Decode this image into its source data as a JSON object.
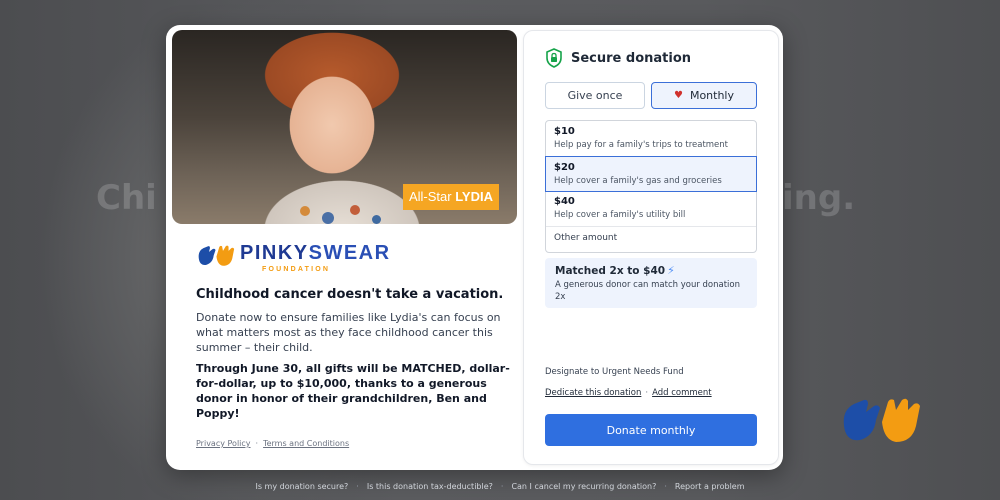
{
  "background": {
    "text_left": "Chi",
    "text_right": "ing."
  },
  "photo": {
    "tag_prefix": "All-Star",
    "tag_name": "LYDIA"
  },
  "brand": {
    "name_part1": "PINKY",
    "name_part2": "SWEAR",
    "sub": "FOUNDATION",
    "accent": "#f39c12",
    "primary": "#1f3a93"
  },
  "content": {
    "headline": "Childhood cancer doesn't take a vacation.",
    "body": "Donate now to ensure families like Lydia's can focus on what matters most as they face childhood cancer this summer – their child.",
    "match_notice": "Through June 30, all gifts will be MATCHED, dollar-for-dollar, up to $10,000, thanks to a generous donor in honor of their grandchildren, Ben and Poppy!"
  },
  "legal": {
    "privacy": "Privacy Policy",
    "separator": "·",
    "terms": "Terms and Conditions"
  },
  "donation": {
    "title": "Secure donation",
    "frequency": {
      "once_label": "Give once",
      "monthly_label": "Monthly",
      "selected": "Monthly"
    },
    "amounts": [
      {
        "value": "$10",
        "desc": "Help pay for a family's trips to treatment",
        "selected": false
      },
      {
        "value": "$20",
        "desc": "Help cover a family's gas and groceries",
        "selected": true
      },
      {
        "value": "$40",
        "desc": "Help cover a family's utility bill",
        "selected": false
      }
    ],
    "other_label": "Other amount",
    "match": {
      "title": "Matched 2x to $40",
      "subtitle": "A generous donor can match your donation 2x"
    },
    "designate": "Designate to Urgent Needs Fund",
    "dedicate_link": "Dedicate this donation",
    "link_separator": "·",
    "comment_link": "Add comment",
    "submit_label": "Donate monthly",
    "submit_color": "#2f6fe0"
  },
  "footer": {
    "links": [
      "Is my donation secure?",
      "Is this donation tax-deductible?",
      "Can I cancel my recurring donation?",
      "Report a problem"
    ],
    "separator": "·"
  }
}
